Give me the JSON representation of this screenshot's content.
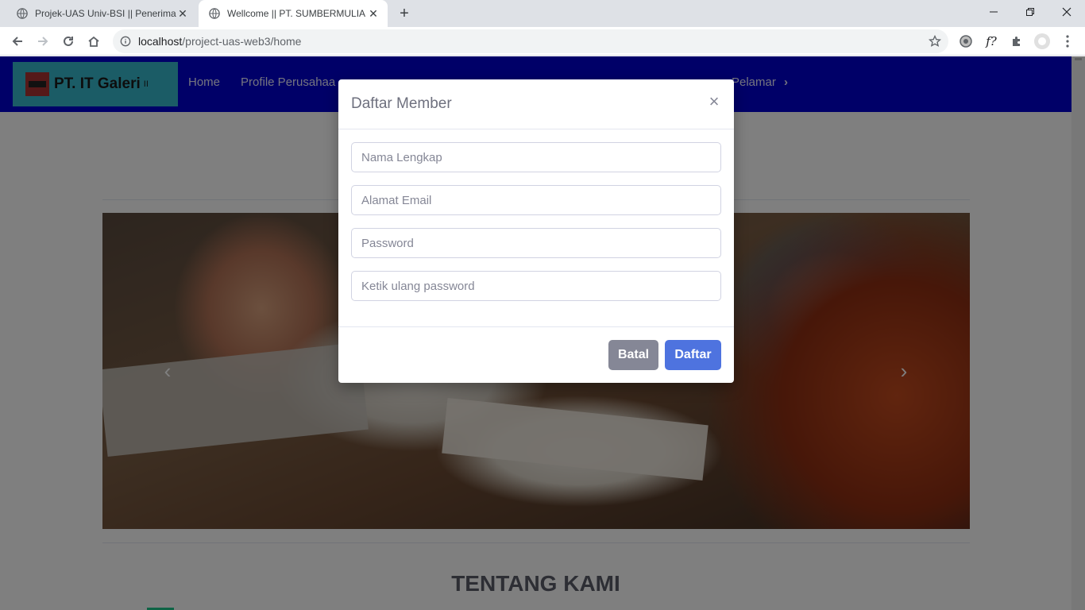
{
  "browser": {
    "tabs": [
      {
        "title": "Projek-UAS Univ-BSI || Penerimaa",
        "active": false
      },
      {
        "title": "Wellcome || PT. SUMBERMULIA H",
        "active": true
      }
    ],
    "url_host": "localhost",
    "url_path": "/project-uas-web3/home",
    "extension_labels": [
      "f?"
    ]
  },
  "navbar": {
    "brand": "PT. IT Galeri",
    "brand_sup": "II",
    "links": [
      "Home",
      "Profile Perusahaa",
      "Pelamar"
    ],
    "chevron": "›"
  },
  "main": {
    "section_title": "TENTANG KAMI",
    "carousel": {
      "prev": "‹",
      "next": "›"
    }
  },
  "modal": {
    "title": "Daftar Member",
    "close": "×",
    "fields": [
      {
        "placeholder": "Nama Lengkap"
      },
      {
        "placeholder": "Alamat Email"
      },
      {
        "placeholder": "Password"
      },
      {
        "placeholder": "Ketik ulang password"
      }
    ],
    "cancel_label": "Batal",
    "submit_label": "Daftar"
  },
  "colors": {
    "navbar_bg": "#0000d1",
    "brand_bg": "#36b9cc",
    "primary": "#4e73df",
    "secondary": "#858796"
  }
}
